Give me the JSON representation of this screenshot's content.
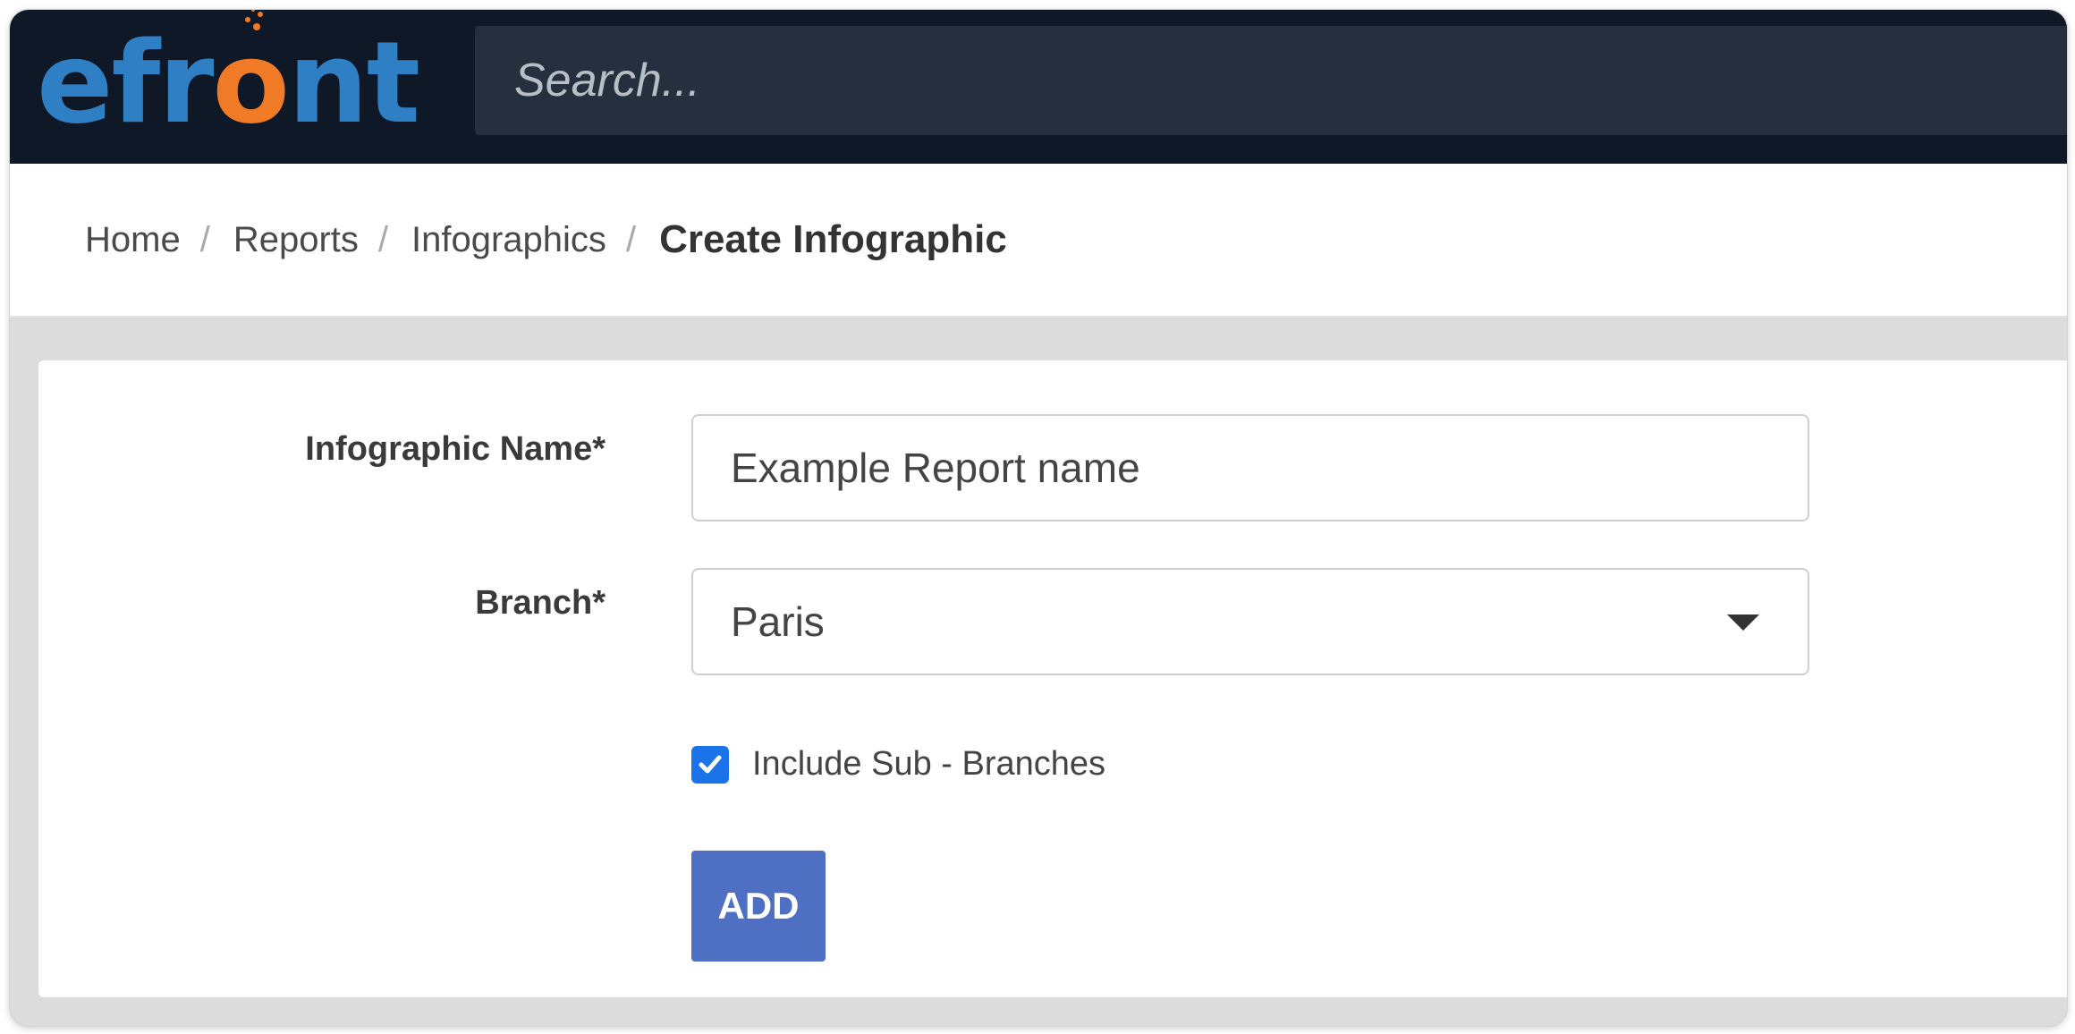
{
  "app": {
    "logo_prefix": "efr",
    "logo_o": "o",
    "logo_suffix": "nt"
  },
  "search": {
    "placeholder": "Search..."
  },
  "breadcrumb": {
    "items": [
      "Home",
      "Reports",
      "Infographics"
    ],
    "separator": "/",
    "current": "Create Infographic"
  },
  "form": {
    "name_label": "Infographic Name*",
    "name_value": "Example Report name",
    "branch_label": "Branch*",
    "branch_value": "Paris",
    "include_sub_label": "Include Sub - Branches",
    "include_sub_checked": true,
    "add_label": "ADD"
  },
  "colors": {
    "topbar": "#0f1826",
    "logo_blue": "#2f7fc4",
    "logo_orange": "#f07a25",
    "accent_button": "#4f6fc2",
    "checkbox": "#1a73e8"
  },
  "icons": {
    "branch_dropdown": "caret-down-icon",
    "include_sub": "check-icon"
  }
}
